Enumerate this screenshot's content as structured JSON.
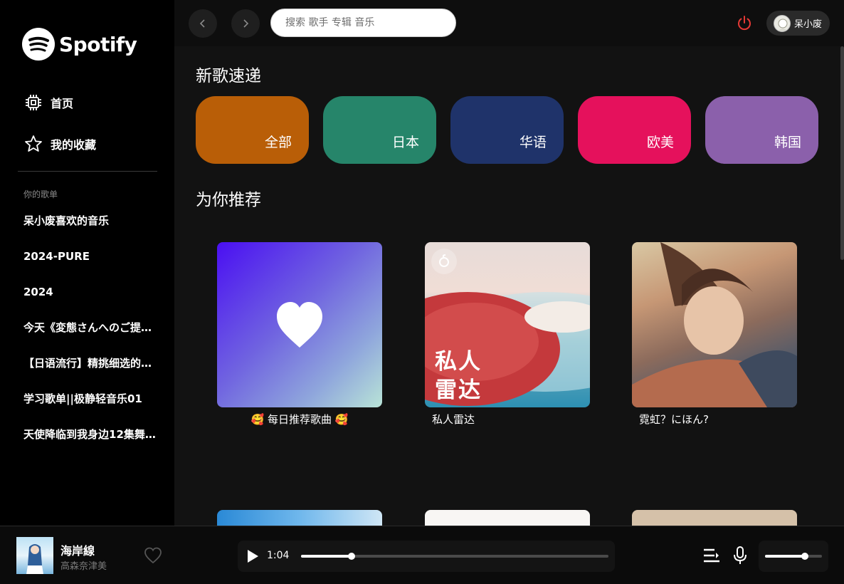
{
  "brand": {
    "name": "Spotify"
  },
  "sidebar": {
    "nav": [
      {
        "label": "首页",
        "icon": "chip-icon"
      },
      {
        "label": "我的收藏",
        "icon": "star-icon"
      }
    ],
    "section_label": "你的歌单",
    "playlists": [
      "呆小废喜欢的音乐",
      "2024-PURE",
      "2024",
      "今天《変態さんへのご提…",
      "【日语流行】精挑细选的…",
      "学习歌单||极静轻音乐01",
      "天使降临到我身边12集舞…"
    ]
  },
  "topbar": {
    "back_icon": "chevron-left-icon",
    "forward_icon": "chevron-right-icon",
    "search_placeholder": "搜索 歌手 专辑 音乐",
    "power_icon": "power-icon",
    "power_color": "#e53935",
    "username": "呆小废"
  },
  "main": {
    "new_title": "新歌速递",
    "genres": [
      {
        "label": "全部",
        "color": "#b95e07"
      },
      {
        "label": "日本",
        "color": "#26856a"
      },
      {
        "label": "华语",
        "color": "#1f336a"
      },
      {
        "label": "欧美",
        "color": "#e5115c"
      },
      {
        "label": "韩国",
        "color": "#8b60ab"
      }
    ],
    "rec_title": "为你推荐",
    "cards": [
      {
        "caption": "🥰 每日推荐歌曲 🥰"
      },
      {
        "caption": "私人雷达",
        "cover_text_1": "私人",
        "cover_text_2": "雷达"
      },
      {
        "caption": "霓虹？にほん?"
      }
    ]
  },
  "player": {
    "title": "海岸線",
    "artist": "高森奈津美",
    "current_time": "1:04",
    "progress": 0.165,
    "volume": 0.7
  }
}
